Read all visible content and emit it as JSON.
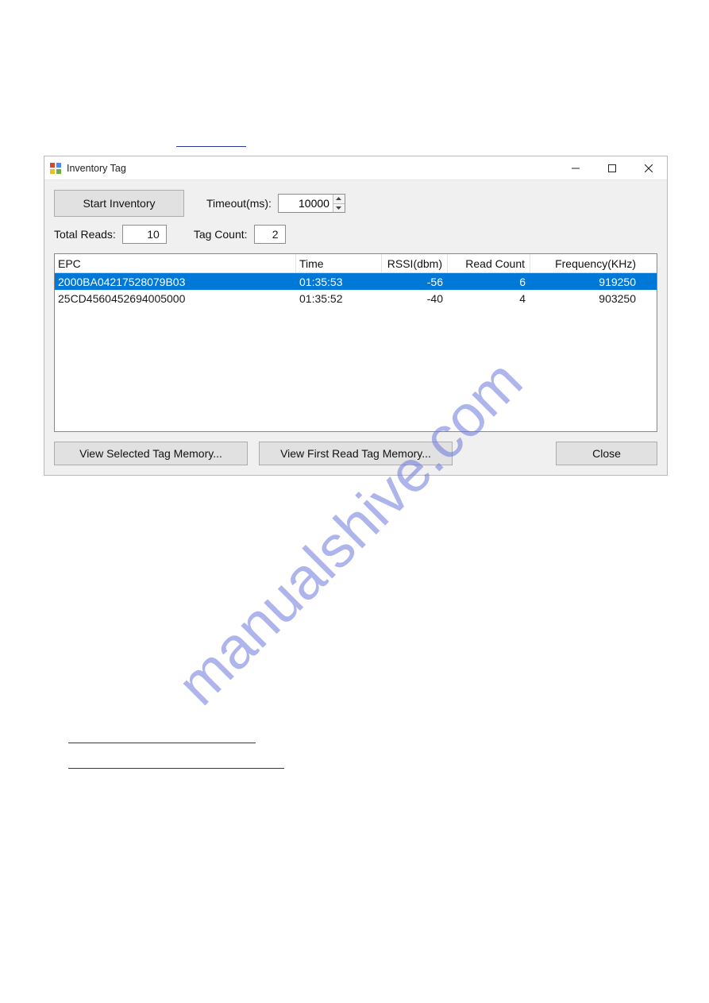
{
  "window": {
    "title": "Inventory Tag"
  },
  "toolbar": {
    "start_inventory_label": "Start Inventory",
    "timeout_label": "Timeout(ms):",
    "timeout_value": "10000",
    "total_reads_label": "Total Reads:",
    "total_reads_value": "10",
    "tag_count_label": "Tag Count:",
    "tag_count_value": "2"
  },
  "grid": {
    "headers": {
      "epc": "EPC",
      "time": "Time",
      "rssi": "RSSI(dbm)",
      "read_count": "Read Count",
      "frequency": "Frequency(KHz)"
    },
    "rows": [
      {
        "epc": "2000BA04217528079B03",
        "time": "01:35:53",
        "rssi": "-56",
        "read_count": "6",
        "frequency": "919250",
        "selected": true
      },
      {
        "epc": "25CD4560452694005000",
        "time": "01:35:52",
        "rssi": "-40",
        "read_count": "4",
        "frequency": "903250",
        "selected": false
      }
    ]
  },
  "buttons": {
    "view_selected": "View Selected Tag Memory...",
    "view_first": "View First Read Tag Memory...",
    "close": "Close"
  },
  "watermark": "manualshive.com"
}
